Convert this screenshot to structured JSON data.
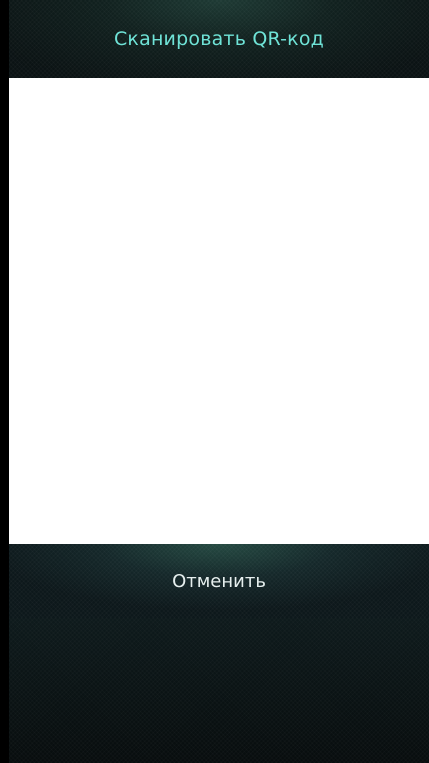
{
  "header": {
    "title": "Сканировать QR-код"
  },
  "scanner": {
    "state": "camera-preview"
  },
  "actions": {
    "cancel_label": "Отменить"
  },
  "colors": {
    "title_accent": "#6fe3d7",
    "panel_dark": "#0b1314",
    "camera_bg": "#ffffff"
  }
}
